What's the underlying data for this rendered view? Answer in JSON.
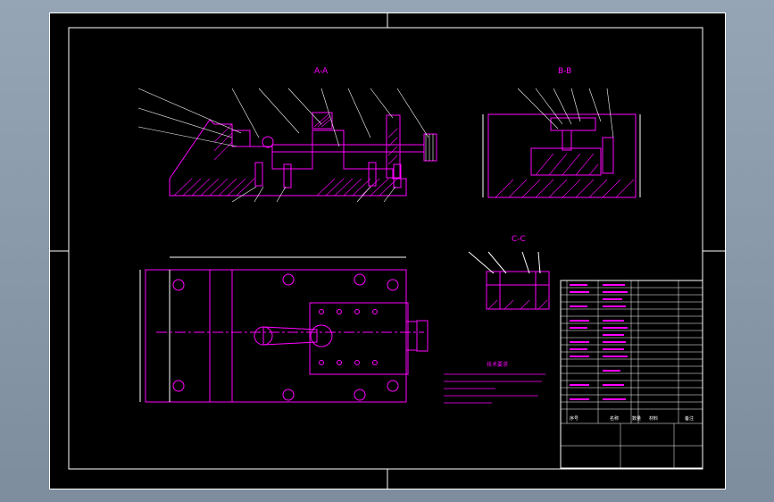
{
  "drawing": {
    "view_labels": {
      "section_aa": "A-A",
      "section_bb": "B-B",
      "section_cc": "C-C"
    },
    "tech_requirements_title": "技术要求",
    "title_block": {
      "header_seq": "序号",
      "header_name": "名称",
      "header_qty": "数量",
      "header_material": "材料",
      "header_note": "备注"
    }
  }
}
